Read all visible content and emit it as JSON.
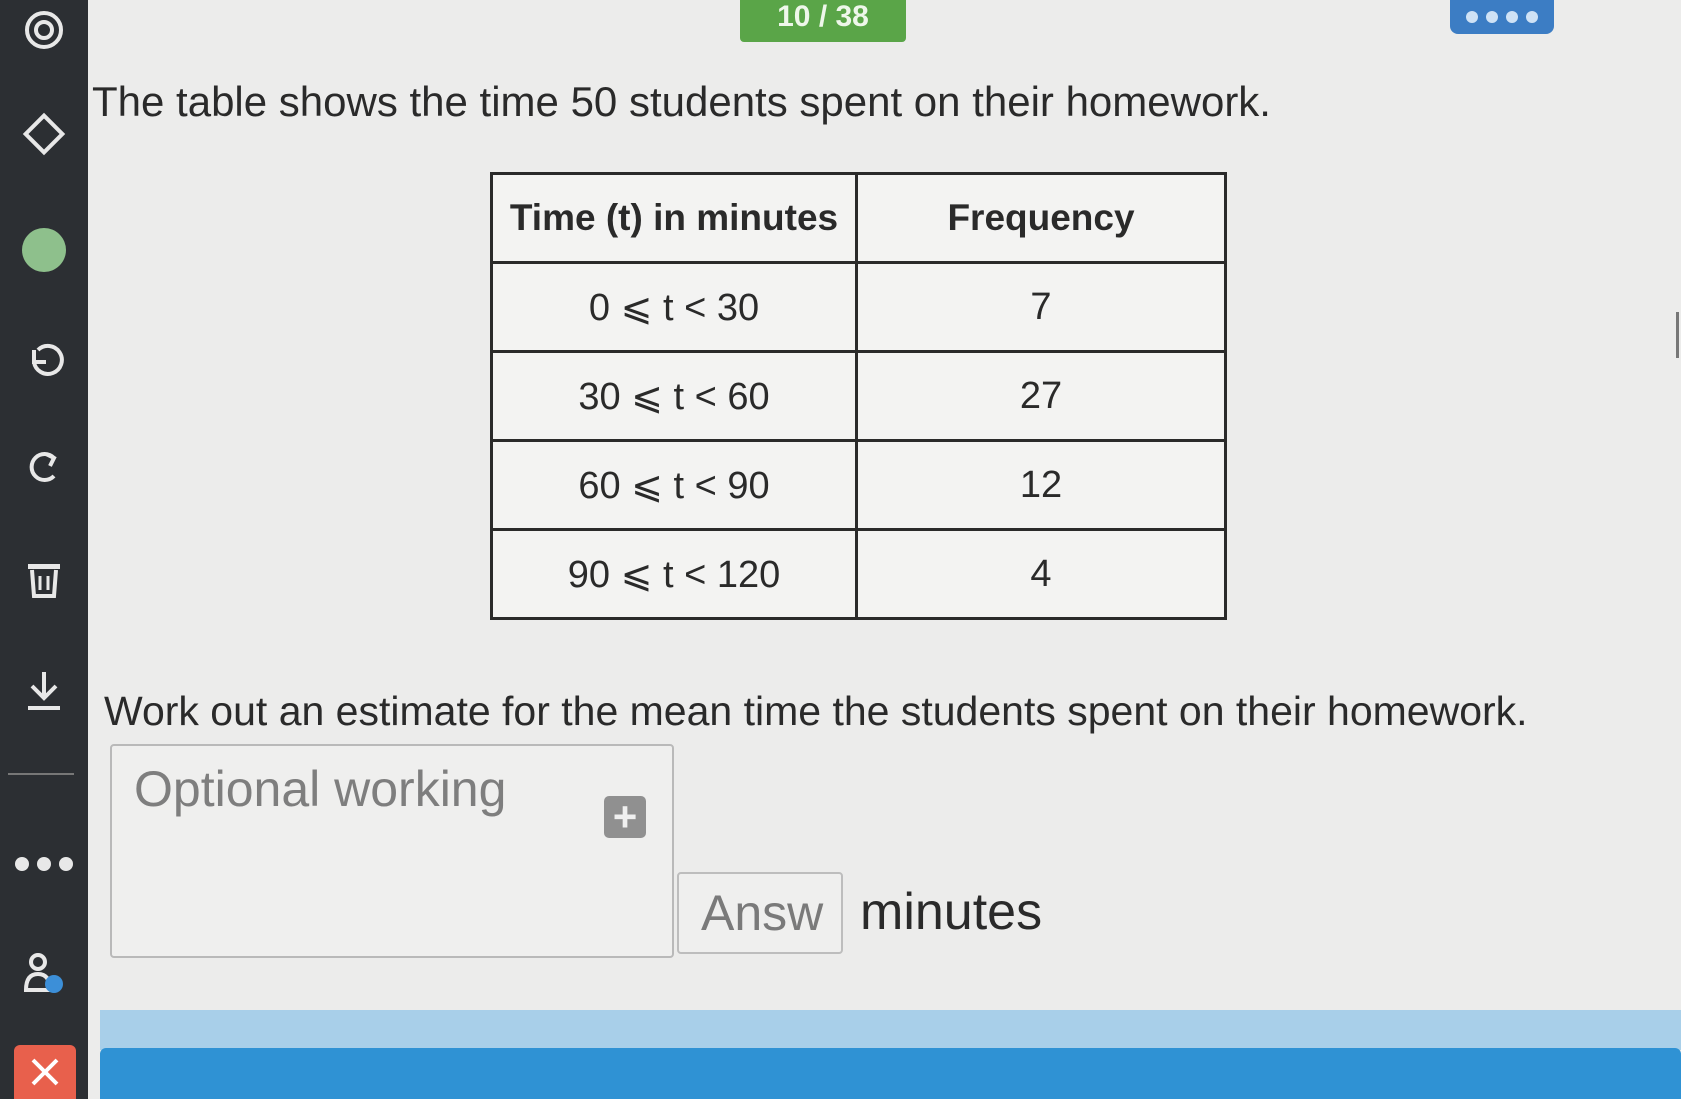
{
  "header": {
    "progress": "10 / 38"
  },
  "sidebar": {
    "items": [
      {
        "name": "target-icon",
        "glyph": "◎"
      },
      {
        "name": "eraser-icon",
        "glyph": "◇"
      },
      {
        "name": "color-dot-icon",
        "color": "#8ec08c"
      },
      {
        "name": "undo-icon",
        "glyph": "↶"
      },
      {
        "name": "redo-icon",
        "glyph": "↷"
      },
      {
        "name": "trash-icon",
        "glyph": "🗑"
      },
      {
        "name": "download-icon",
        "glyph": "⤓"
      },
      {
        "name": "more-icon",
        "glyph": "•••"
      },
      {
        "name": "user-help-icon",
        "glyph": "♙"
      }
    ]
  },
  "question": {
    "intro": "The table shows the time 50 students spent on their homework.",
    "table": {
      "headers": [
        "Time (t) in minutes",
        "Frequency"
      ],
      "rows": [
        [
          "0 ⩽ t < 30",
          "7"
        ],
        [
          "30 ⩽ t < 60",
          "27"
        ],
        [
          "60 ⩽ t < 90",
          "12"
        ],
        [
          "90 ⩽ t < 120",
          "4"
        ]
      ]
    },
    "instruction": "Work out an estimate for the mean time the students spent on their homework."
  },
  "working": {
    "placeholder": "Optional working",
    "plus_glyph": "+"
  },
  "answer": {
    "placeholder": "Answ",
    "unit": "minutes"
  },
  "colors": {
    "sidebar": "#2c2f33",
    "progress": "#5aa548",
    "close": "#e8604c",
    "bottom_bar": "#2f92d4"
  }
}
